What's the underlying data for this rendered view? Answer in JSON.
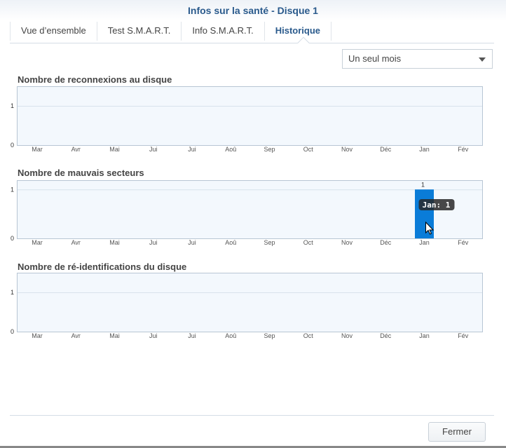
{
  "window": {
    "title": "Infos sur la santé - Disque 1"
  },
  "tabs": [
    {
      "label": "Vue d’ensemble"
    },
    {
      "label": "Test S.M.A.R.T."
    },
    {
      "label": "Info S.M.A.R.T."
    },
    {
      "label": "Historique",
      "active": true
    }
  ],
  "period_select": {
    "value": "Un seul mois"
  },
  "footer": {
    "close_label": "Fermer"
  },
  "colors": {
    "bar": "#0a7cd8",
    "plot_bg": "#f3f8fd",
    "border": "#b8c6d4"
  },
  "chart_data": [
    {
      "type": "bar",
      "title": "Nombre de reconnexions au disque",
      "categories": [
        "Mar",
        "Avr",
        "Mai",
        "Jui",
        "Jui",
        "Aoû",
        "Sep",
        "Oct",
        "Nov",
        "Déc",
        "Jan",
        "Fév"
      ],
      "values": [
        0,
        0,
        0,
        0,
        0,
        0,
        0,
        0,
        0,
        0,
        0,
        0
      ],
      "yticks": [
        "0",
        "1"
      ],
      "ylim": [
        0,
        1.5
      ]
    },
    {
      "type": "bar",
      "title": "Nombre de mauvais secteurs",
      "categories": [
        "Mar",
        "Avr",
        "Mai",
        "Jui",
        "Jui",
        "Aoû",
        "Sep",
        "Oct",
        "Nov",
        "Déc",
        "Jan",
        "Fév"
      ],
      "values": [
        0,
        0,
        0,
        0,
        0,
        0,
        0,
        0,
        0,
        0,
        1,
        0
      ],
      "data_labels": {
        "Jan": "1"
      },
      "tooltip": "Jan: 1",
      "yticks": [
        "0",
        "1"
      ],
      "ylim": [
        0,
        1.19
      ]
    },
    {
      "type": "bar",
      "title": "Nombre de ré-identifications du disque",
      "categories": [
        "Mar",
        "Avr",
        "Mai",
        "Jui",
        "Jui",
        "Aoû",
        "Sep",
        "Oct",
        "Nov",
        "Déc",
        "Jan",
        "Fév"
      ],
      "values": [
        0,
        0,
        0,
        0,
        0,
        0,
        0,
        0,
        0,
        0,
        0,
        0
      ],
      "yticks": [
        "0",
        "1"
      ],
      "ylim": [
        0,
        1.5
      ]
    }
  ]
}
